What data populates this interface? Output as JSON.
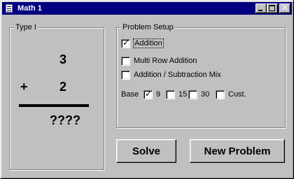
{
  "window": {
    "title": "Math 1",
    "app_icon": "document-icon"
  },
  "title_controls": {
    "minimize_icon": "minimize-icon",
    "maximize_icon": "maximize-icon",
    "close_glyph": "✕"
  },
  "problem_panel": {
    "label": "Type I",
    "top_number": "3",
    "operator": "+",
    "second_number": "2",
    "answer": "????"
  },
  "setup": {
    "label": "Problem Setup",
    "options": [
      {
        "label": "Addition",
        "checked": true
      },
      {
        "label": "Multi Row Addition",
        "checked": false
      },
      {
        "label": "Addition / Subtraction Mix",
        "checked": false
      }
    ],
    "base_label": "Base",
    "bases": [
      {
        "label": "9",
        "checked": true
      },
      {
        "label": "15",
        "checked": false
      },
      {
        "label": "30",
        "checked": false
      },
      {
        "label": "Cust.",
        "checked": false
      }
    ],
    "check_glyph": "✓"
  },
  "buttons": {
    "solve": "Solve",
    "new_problem": "New Problem"
  }
}
